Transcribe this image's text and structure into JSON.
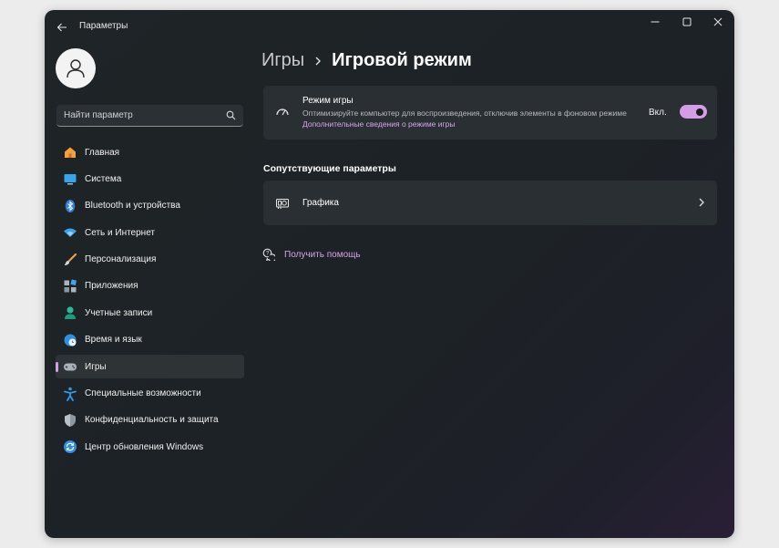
{
  "window": {
    "title": "Параметры",
    "back_icon": "arrow-left-icon",
    "controls": [
      "minimize-icon",
      "maximize-icon",
      "close-icon"
    ]
  },
  "sidebar": {
    "search": {
      "placeholder": "Найти параметр",
      "value": ""
    },
    "items": [
      {
        "label": "Главная",
        "icon": "home-icon",
        "active": false
      },
      {
        "label": "Система",
        "icon": "monitor-icon",
        "active": false
      },
      {
        "label": "Bluetooth и устройства",
        "icon": "bluetooth-icon",
        "active": false
      },
      {
        "label": "Сеть и Интернет",
        "icon": "wifi-icon",
        "active": false
      },
      {
        "label": "Персонализация",
        "icon": "brush-icon",
        "active": false
      },
      {
        "label": "Приложения",
        "icon": "apps-icon",
        "active": false
      },
      {
        "label": "Учетные записи",
        "icon": "person-icon",
        "active": false
      },
      {
        "label": "Время и язык",
        "icon": "globe-clock-icon",
        "active": false
      },
      {
        "label": "Игры",
        "icon": "gamepad-icon",
        "active": true
      },
      {
        "label": "Специальные возможности",
        "icon": "accessibility-icon",
        "active": false
      },
      {
        "label": "Конфиденциальность и защита",
        "icon": "shield-icon",
        "active": false
      },
      {
        "label": "Центр обновления Windows",
        "icon": "update-icon",
        "active": false
      }
    ]
  },
  "main": {
    "breadcrumb": {
      "parent": "Игры",
      "current": "Игровой режим"
    },
    "game_mode": {
      "title": "Режим игры",
      "description": "Оптимизируйте компьютер для воспроизведения, отключив элементы в фоновом режиме",
      "link": "Дополнительные сведения о режиме игры",
      "toggle_label": "Вкл.",
      "toggle_on": true
    },
    "related": {
      "title": "Сопутствующие параметры",
      "graphics_label": "Графика"
    },
    "help_label": "Получить помощь"
  },
  "colors": {
    "accent": "#d49ee6",
    "link": "#d6a4ea",
    "card_bg": "#2a2f33",
    "window_bg": "#1f2427"
  }
}
